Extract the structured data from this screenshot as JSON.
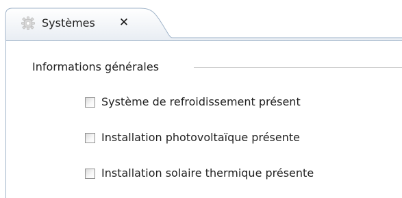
{
  "colors": {
    "tab_gradient_top": "#ffffff",
    "tab_gradient_bottom": "#e8edf3",
    "tab_border": "#9fb3c8",
    "gear_color": "#d8d8d8"
  },
  "tab": {
    "label": "Systèmes",
    "icon": "gear-icon",
    "close_label": "✕",
    "close_icon": "close-icon",
    "active": true
  },
  "group": {
    "title": "Informations générales"
  },
  "checkboxes": [
    {
      "label": "Système de refroidissement présent",
      "checked": false
    },
    {
      "label": "Installation photovoltaïque présente",
      "checked": false
    },
    {
      "label": "Installation solaire thermique présente",
      "checked": false
    }
  ]
}
